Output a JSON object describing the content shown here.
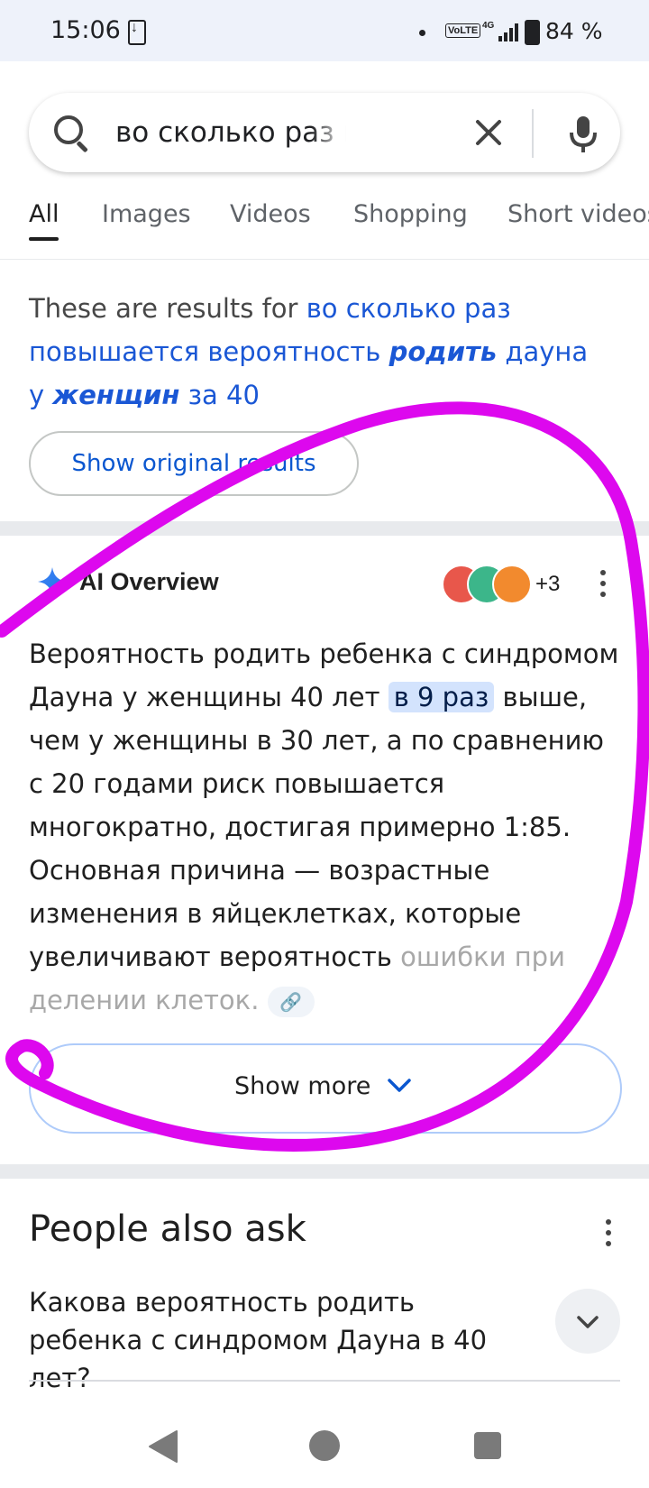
{
  "status_bar": {
    "time": "15:06",
    "network": "VoLTE",
    "network_gen": "4G",
    "battery": "84 %"
  },
  "search": {
    "query": "во сколько раз повышается",
    "icons": [
      "search-icon",
      "close-icon",
      "mic-icon"
    ]
  },
  "tabs": [
    {
      "label": "All"
    },
    {
      "label": "Images"
    },
    {
      "label": "Videos"
    },
    {
      "label": "Shopping"
    },
    {
      "label": "Short videos"
    }
  ],
  "results_for": {
    "prefix": "These are results for",
    "link_1": "во сколько раз повышается вероятность",
    "bold_1": "родить",
    "link_2": "дауна у",
    "bold_2": "женщин",
    "link_3": "за 40",
    "button": "Show original results"
  },
  "ai_overview": {
    "title": "AI Overview",
    "sources_more": "+3",
    "text_1": "Вероятность родить ребенка с синдромом Дауна у женщины 40 лет",
    "highlight": "в 9 раз",
    "text_2": "выше, чем у женщины в 30 лет, а по сравнению с 20 годами риск повышается многократно, достигая примерно 1:85. Основная причина — возрастные изменения в яйцеклетках, которые увеличивают вероятность",
    "text_faded": "ошибки при делении клеток.",
    "show_more": "Show more",
    "colors": {
      "highlight_bg": "#d3e3fd",
      "annotation_stroke": "#dd08ee"
    }
  },
  "people_also_ask": {
    "title": "People also ask",
    "question": "Какова вероятность родить ребенка с синдромом Дауна в 40 лет?"
  },
  "nav_bar": {
    "icons": [
      "back-icon",
      "home-icon",
      "recents-icon"
    ]
  }
}
